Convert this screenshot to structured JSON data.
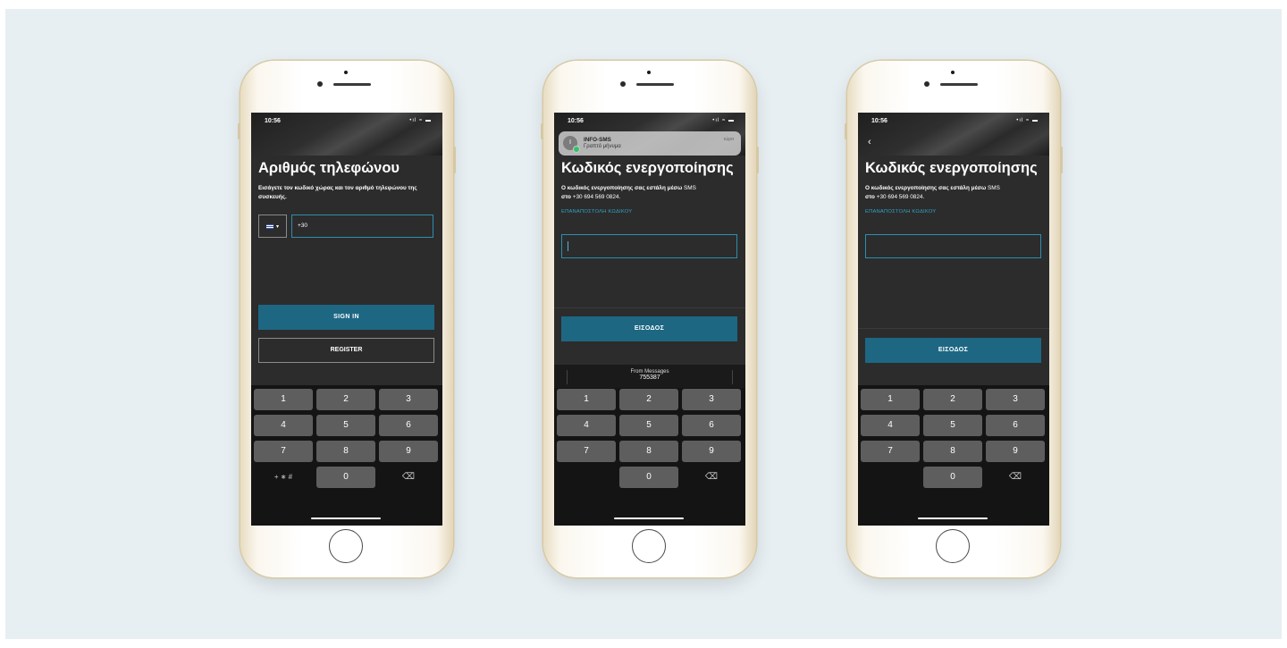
{
  "status": {
    "time": "10:56",
    "icons": "•ıl ≈ ▬"
  },
  "screens": {
    "phone_number": {
      "title": "Αριθμός τηλεφώνου",
      "subtitle": "Εισάγετε τον κωδικό χώρας και τον αριθμό τηλεφώνου της συσκευής.",
      "country_code_prefix": "+30",
      "country_caret": "▾",
      "sign_in_label": "SIGN IN",
      "register_label": "REGISTER"
    },
    "activation_notification": {
      "title": "Κωδικός ενεργοποίησης",
      "subtitle_bold": "Ο κωδικός ενεργοποίησης σας εστάλη μέσω",
      "subtitle_sms": "SMS",
      "subtitle_to": "στο",
      "phone_display": "+30 694 569 0824.",
      "resend_label": "ΕΠΑΝΑΠΟΣΤΟΛΗ ΚΩΔΙΚΟΥ",
      "enter_label": "ΕΙΣΟΔΟΣ",
      "notification": {
        "avatar": "I",
        "sender": "INFO-SMS",
        "message": "Γραπτό μήνυμα",
        "when": "τώρα"
      },
      "suggestion": {
        "source": "From Messages",
        "code": "755387"
      }
    },
    "activation": {
      "back": "‹",
      "title": "Κωδικός ενεργοποίησης",
      "subtitle_bold": "Ο κωδικός ενεργοποίησης σας εστάλη μέσω",
      "subtitle_sms": "SMS",
      "subtitle_to": "στο",
      "phone_display": "+30 694 569 0824.",
      "resend_label": "ΕΠΑΝΑΠΟΣΤΟΛΗ ΚΩΔΙΚΟΥ",
      "enter_label": "ΕΙΣΟΔΟΣ"
    }
  },
  "keypad": {
    "keys": [
      "1",
      "2",
      "3",
      "4",
      "5",
      "6",
      "7",
      "8",
      "9",
      "0"
    ],
    "symbols": "+ ∗ #",
    "backspace": "⌫"
  },
  "colors": {
    "accent": "#1d6783",
    "link": "#2fa3c7",
    "background": "#e7eff3",
    "screen": "#2c2c2c"
  }
}
